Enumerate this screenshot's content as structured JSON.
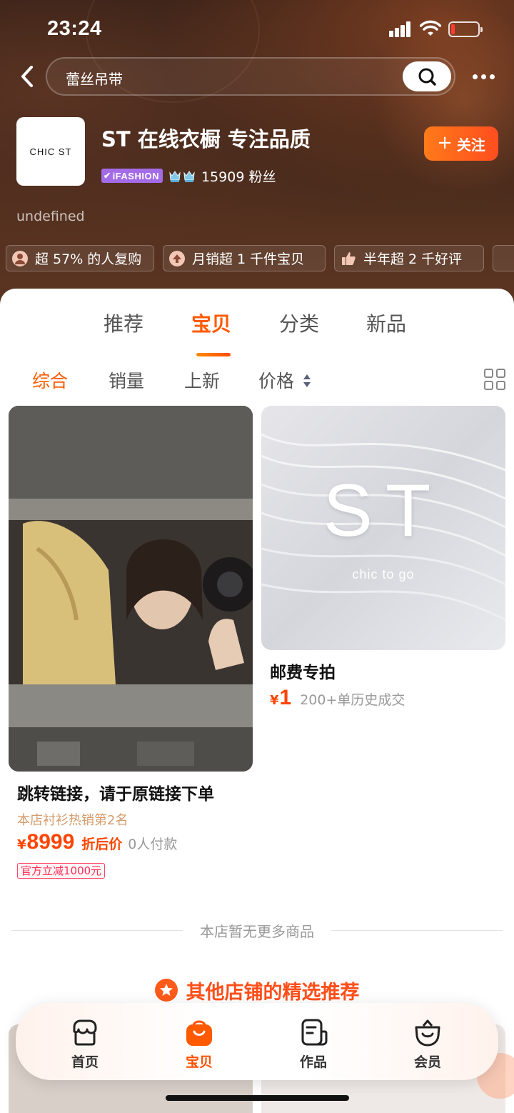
{
  "status": {
    "time": "23:24"
  },
  "search": {
    "query": "蕾丝吊带"
  },
  "shop": {
    "logo_text": "CHIC ST",
    "name": "ST 在线衣橱 专注品质",
    "badge": "iFASHION",
    "fans": "15909 粉丝",
    "follow_label": "关注",
    "description": "undefined"
  },
  "tags": [
    {
      "label": "超 57% 的人复购",
      "icon": "person-icon"
    },
    {
      "label": "月销超 1 千件宝贝",
      "icon": "arrow-up-icon"
    },
    {
      "label": "半年超 2 千好评",
      "icon": "thumbs-up-icon"
    }
  ],
  "tabs": [
    "推荐",
    "宝贝",
    "分类",
    "新品"
  ],
  "active_tab": "宝贝",
  "sorts": [
    "综合",
    "销量",
    "上新",
    "价格"
  ],
  "products": [
    {
      "title": "跳转链接，请于原链接下单",
      "rank": "本店衬衫热销第2名",
      "currency": "¥",
      "price": "8999",
      "price_note": "折后价",
      "sold": "0人付款",
      "coupon": "官方立减1000元"
    },
    {
      "title": "邮费专拍",
      "image_text": "ST",
      "image_subtext": "chic to go",
      "currency": "¥",
      "price": "1",
      "sold": "200+单历史成交"
    }
  ],
  "no_more": "本店暂无更多商品",
  "recommend_title": "其他店铺的精选推荐",
  "bottom_nav": [
    {
      "label": "首页",
      "icon": "shop-icon"
    },
    {
      "label": "宝贝",
      "icon": "bag-icon"
    },
    {
      "label": "作品",
      "icon": "works-icon"
    },
    {
      "label": "会员",
      "icon": "member-icon"
    }
  ],
  "colors": {
    "accent": "#ff5a00",
    "price": "#ff4400",
    "badge": "#a46be6"
  }
}
